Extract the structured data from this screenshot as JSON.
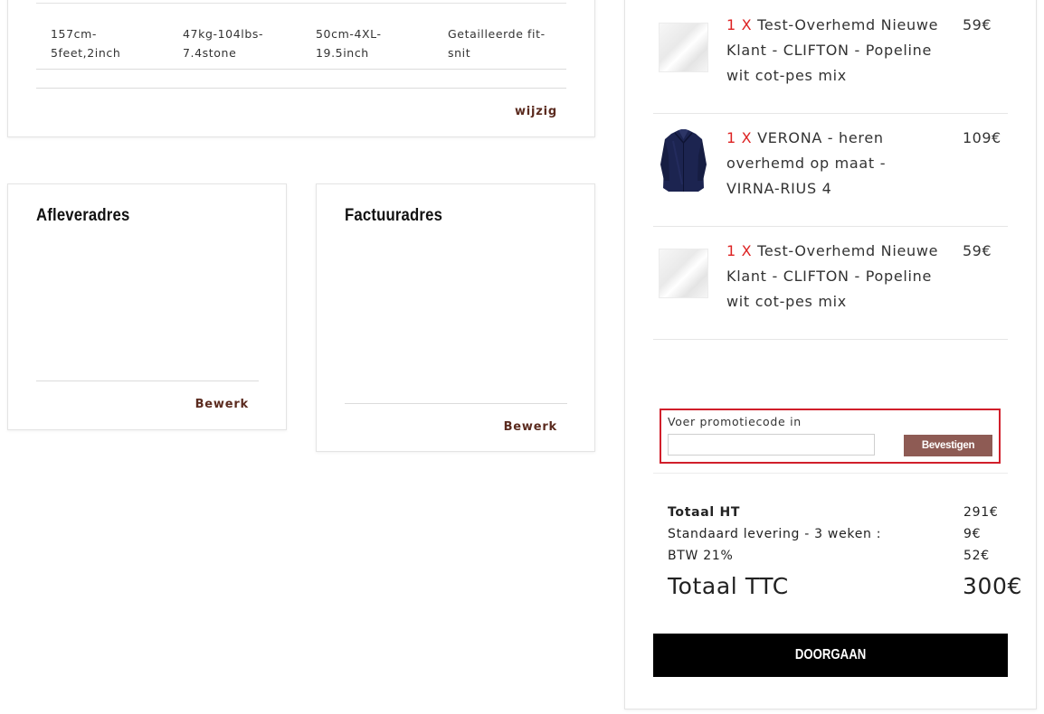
{
  "measurements": {
    "cells": [
      "157cm-\n5feet,2inch",
      "47kg-104lbs-\n7.4stone",
      "50cm-4XL-\n19.5inch",
      "Getailleerde fit-\nsnit"
    ],
    "edit_label": "wijzig"
  },
  "delivery": {
    "title": "Afleveradres",
    "edit_label": "Bewerk"
  },
  "billing": {
    "title": "Factuuradres",
    "edit_label": "Bewerk"
  },
  "cart": {
    "items": [
      {
        "qty": "1 X",
        "name": "Test-Overhemd Nieuwe Klant - CLIFTON - Popeline wit cot-pes mix",
        "price": "59€",
        "thumb": "white-fabric"
      },
      {
        "qty": "1 X",
        "name": "VERONA - heren overhemd op maat - VIRNA-RIUS 4",
        "price": "109€",
        "thumb": "navy-shirt"
      },
      {
        "qty": "1 X",
        "name": "Test-Overhemd Nieuwe Klant - CLIFTON - Popeline wit cot-pes mix",
        "price": "59€",
        "thumb": "white-fabric"
      }
    ],
    "promo": {
      "label": "Voer promotiecode in",
      "value": "",
      "placeholder": "",
      "button": "Bevestigen"
    },
    "totals": {
      "subtotal_label": "Totaal HT",
      "subtotal_value": "291€",
      "shipping_label": "Standaard levering - 3 weken :",
      "shipping_value": "9€",
      "vat_label": "BTW 21%",
      "vat_value": "52€",
      "total_label": "Totaal TTC",
      "total_value": "300€"
    },
    "proceed_label": "DOORGAAN"
  },
  "colors": {
    "accent_brown": "#5b2b1f",
    "button_brown": "#8e5b54",
    "qty_red": "#dd2222",
    "highlight_red": "#d11f2b"
  }
}
